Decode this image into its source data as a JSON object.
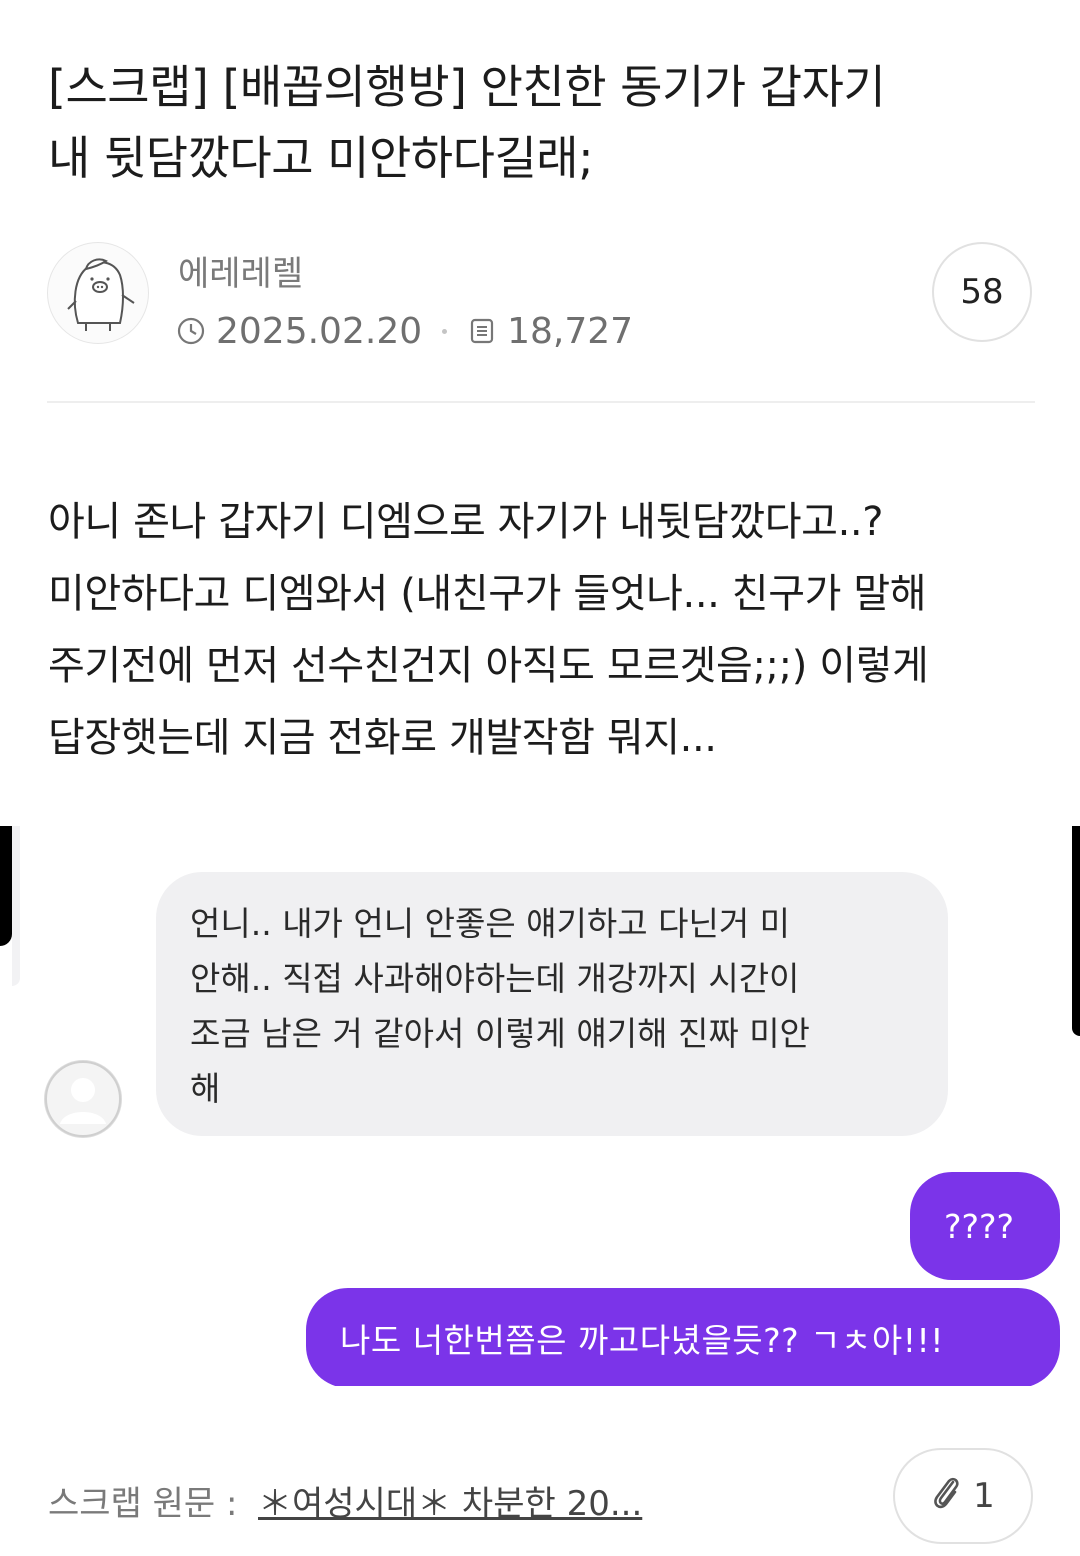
{
  "post": {
    "title_line1": "[스크랩] [배꼽의행방] 안친한 동기가 갑자기",
    "title_line2": "내 뒷담깠다고 미안하다길래;",
    "author": "에레레렐",
    "date": "2025.02.20",
    "views": "18,727",
    "comment_count": "58",
    "body_lines": [
      "아니 존나 갑자기 디엠으로 자기가 내뒷담깠다고..?",
      "미안하다고 디엠와서 (내친구가 들엇나... 친구가 말해",
      "주기전에 먼저 선수친건지 아직도 모르겟음;;;) 이렇게",
      "답장햇는데 지금 전화로 개발작함 뭐지..."
    ]
  },
  "chat": {
    "incoming_lines": [
      "언니.. 내가 언니 안좋은 얘기하고 다닌거 미",
      "안해.. 직접 사과해야하는데 개강까지 시간이",
      "조금 남은 거 같아서 이렇게 얘기해 진짜 미안",
      "해"
    ],
    "outgoing_1": "????",
    "outgoing_2": "나도 너한번쯤은 까고다녔을듯?? ㄱㅊ아!!!"
  },
  "footer": {
    "scrap_label": "스크랩 원문 :",
    "scrap_link": "＊여성시대＊ 차분한 20...",
    "attachment_count": "1"
  },
  "colors": {
    "accent_purple": "#7b34e9",
    "incoming_bubble": "#f0f0f2",
    "meta_gray": "#6f6f6f"
  },
  "icons": [
    "clock-icon",
    "document-icon",
    "paperclip-icon",
    "profile-placeholder-icon"
  ]
}
